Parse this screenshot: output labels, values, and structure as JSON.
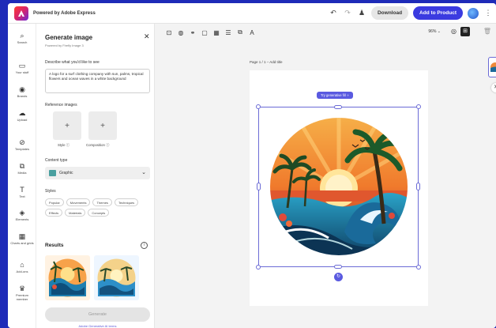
{
  "header": {
    "brand": "Powered by Adobe Express",
    "download_label": "Download",
    "add_to_product_label": "Add to Product"
  },
  "rail": [
    {
      "label": "Search",
      "icon": "search-icon"
    },
    {
      "label": "Your stuff",
      "icon": "folder-icon"
    },
    {
      "label": "Brands",
      "icon": "brand-icon"
    },
    {
      "label": "Upload",
      "icon": "upload-icon"
    },
    {
      "label": "Templates",
      "icon": "templates-icon"
    },
    {
      "label": "Media",
      "icon": "media-icon"
    },
    {
      "label": "Text",
      "icon": "text-icon"
    },
    {
      "label": "Elements",
      "icon": "elements-icon"
    },
    {
      "label": "Charts and grids",
      "icon": "chart-icon"
    },
    {
      "label": "Add-ons",
      "icon": "addons-icon"
    },
    {
      "label": "Premium member",
      "icon": "crown-icon"
    }
  ],
  "panel": {
    "title": "Generate image",
    "subtitle": "Powered by Firefly Image 3",
    "prompt_label": "Describe what you'd like to see",
    "prompt_value": "A logo for a surf clothing company with sun, palms, tropical flowers and ocean waves in a white background",
    "reference_label": "Reference images",
    "ref_style_label": "Style",
    "ref_composition_label": "Composition",
    "content_type_label": "Content type",
    "content_type_value": "Graphic",
    "styles_label": "Styles",
    "style_chips": [
      "Popular",
      "Movements",
      "Themes",
      "Techniques",
      "Effects",
      "Materials",
      "Concepts"
    ],
    "results_label": "Results",
    "generate_label": "Generate",
    "terms_label": "Adobe Generative AI terms"
  },
  "canvas": {
    "zoom": "96%",
    "page_label": "Page 1 / 1 – Add title",
    "ai_tag": "Try generative fill"
  }
}
